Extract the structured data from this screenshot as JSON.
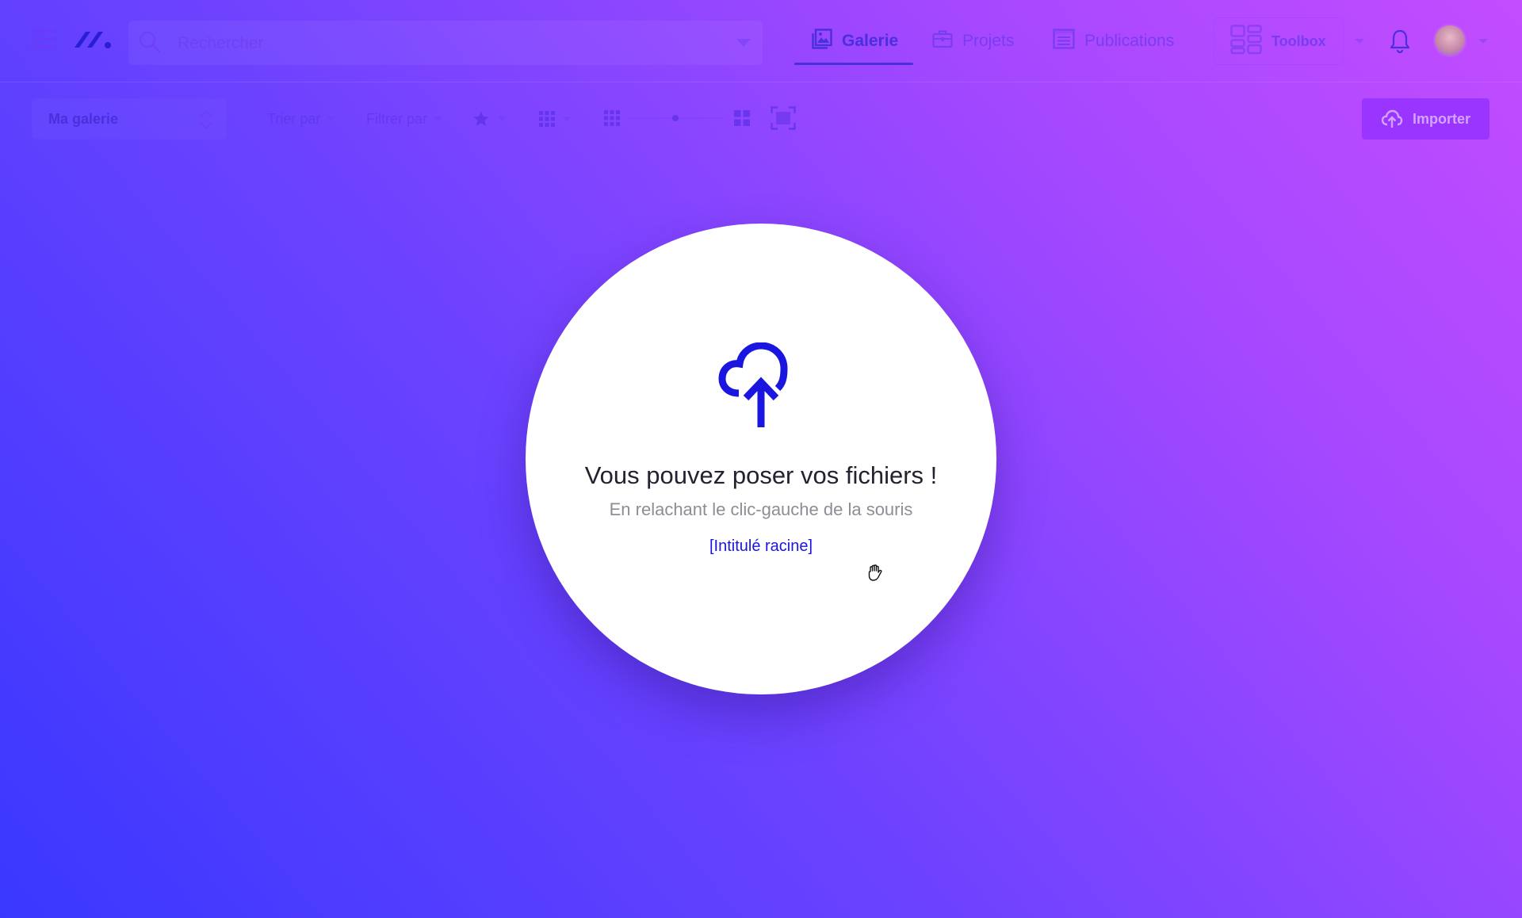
{
  "header": {
    "search": {
      "placeholder": "Rechercher",
      "value": ""
    },
    "tabs": [
      {
        "label": "Galerie",
        "icon": "image-icon",
        "active": true
      },
      {
        "label": "Projets",
        "icon": "briefcase-icon",
        "active": false
      },
      {
        "label": "Publications",
        "icon": "newspaper-icon",
        "active": false
      }
    ],
    "toolbox": {
      "label": "Toolbox",
      "icon": "dashboard-icon"
    },
    "icons": [
      "menu-icon",
      "logo-icon",
      "search-icon",
      "bell-icon",
      "avatar"
    ]
  },
  "toolbar": {
    "gallery_select": "Ma galerie",
    "sort_label": "Trier par",
    "filter_label": "Filtrer par",
    "import_label": "Importer",
    "zoom_level": 0.5
  },
  "drop_zone": {
    "title": "Vous pouvez poser vos fichiers !",
    "subtitle": "En relachant le clic-gauche de la souris",
    "target": "[Intitulé racine]"
  },
  "colors": {
    "accent": "#1a16e0",
    "active_tab": "#4a2fdc",
    "import_button": "#9a35ff",
    "background_start": "#3a38ff",
    "background_end": "#c34cff"
  }
}
